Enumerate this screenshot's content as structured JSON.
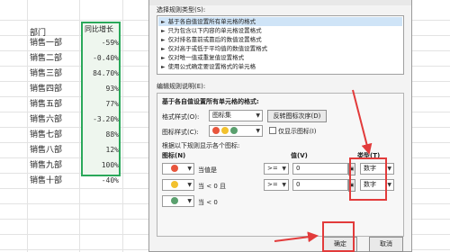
{
  "sheet": {
    "dept_header": "部门",
    "growth_header": "同比增长",
    "rows": [
      {
        "dept": "销售一部",
        "growth": "-59%"
      },
      {
        "dept": "销售二部",
        "growth": "-0.40%"
      },
      {
        "dept": "销售三部",
        "growth": "84.70%"
      },
      {
        "dept": "销售四部",
        "growth": "93%"
      },
      {
        "dept": "销售五部",
        "growth": "77%"
      },
      {
        "dept": "销售六部",
        "growth": "-3.20%"
      },
      {
        "dept": "销售七部",
        "growth": "88%"
      },
      {
        "dept": "销售八部",
        "growth": "12%"
      },
      {
        "dept": "销售九部",
        "growth": "100%"
      },
      {
        "dept": "销售十部",
        "growth": "-40%"
      }
    ],
    "highlight_color": "#2aa85a"
  },
  "dialog": {
    "rule_type_label": "选择规则类型(S):",
    "rule_types": [
      "基于各自值设置所有单元格的格式",
      "只为包含以下内容的单元格设置格式",
      "仅对排名靠前或靠后的数值设置格式",
      "仅对高于或低于平均值的数值设置格式",
      "仅对唯一值或重复值设置格式",
      "使用公式确定要设置格式的单元格"
    ],
    "edit_label": "编辑规则说明(E):",
    "edit_title": "基于各自值设置所有单元格的格式:",
    "format_style_label": "格式样式(O):",
    "format_style_value": "图标集",
    "reverse_btn": "反转图标次序(D)",
    "icon_style_label": "图标样式(C):",
    "show_icon_only_label": "仅显示图标(I)",
    "rule_desc": "根据以下规则显示各个图标:",
    "icon_header": "图标(N)",
    "value_header": "值(V)",
    "type_header": "类型(T)",
    "rules": [
      {
        "icon_color": "#e8553c",
        "cond_text": "当值是",
        "op": ">=",
        "value": "0",
        "type": "数字"
      },
      {
        "icon_color": "#f2c12e",
        "cond_text": "当 < 0 且",
        "op": ">=",
        "value": "0",
        "type": "数字"
      },
      {
        "icon_color": "#5aa06e",
        "cond_text": "当 < 0",
        "op": "",
        "value": "",
        "type": ""
      }
    ],
    "ok_btn": "确定",
    "cancel_btn": "取消"
  },
  "annotation_color": "#e23b3b"
}
